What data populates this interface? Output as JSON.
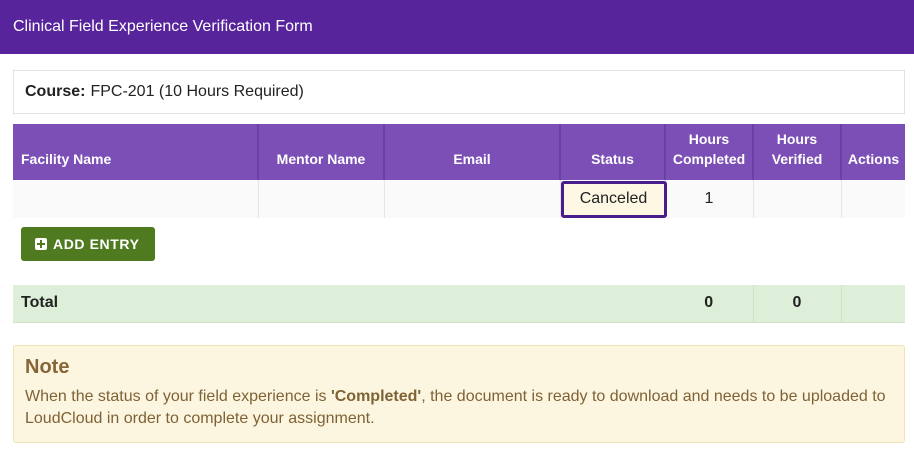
{
  "header": {
    "title": "Clinical Field Experience Verification Form"
  },
  "course": {
    "label": "Course:",
    "value": "FPC-201 (10 Hours Required)"
  },
  "table": {
    "columns": {
      "facility": "Facility Name",
      "mentor": "Mentor Name",
      "email": "Email",
      "status": "Status",
      "hours_completed": "Hours Completed",
      "hours_verified": "Hours Verified",
      "actions": "Actions"
    },
    "rows": [
      {
        "facility": "",
        "mentor": "",
        "email": "",
        "status": "Canceled",
        "hours_completed": "1",
        "hours_verified": "",
        "actions": ""
      }
    ],
    "add_entry_label": "ADD ENTRY",
    "total": {
      "label": "Total",
      "hours_completed": "0",
      "hours_verified": "0"
    }
  },
  "note": {
    "title": "Note",
    "text_before": "When the status of your field experience is ",
    "highlight": "'Completed'",
    "text_after": ", the document is ready to download and needs to be uploaded to LoudCloud in order to complete your assignment."
  },
  "colors": {
    "header_bg": "#57249c",
    "table_header_bg": "#7b4fb6",
    "add_button_bg": "#4f7a1f",
    "total_row_bg": "#ddefd8",
    "note_bg": "#fcf6e1"
  }
}
